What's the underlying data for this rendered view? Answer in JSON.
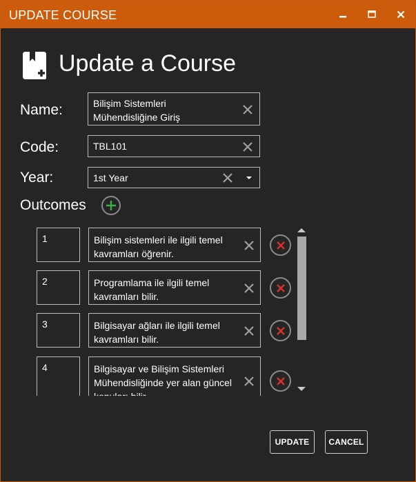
{
  "window": {
    "title": "UPDATE COURSE",
    "accent_color": "#cc5c0b",
    "background_color": "#252526",
    "controls": [
      "minimize-icon",
      "maximize-icon",
      "close-icon"
    ]
  },
  "header": {
    "icon": "book-add-icon",
    "title": "Update a Course"
  },
  "form": {
    "name_label": "Name:",
    "name_value": "Bilişim Sistemleri\nMühendisliğine Giriş",
    "code_label": "Code:",
    "code_value": "TBL101",
    "year_label": "Year:",
    "year_value": "1st Year",
    "outcomes_label": "Outcomes"
  },
  "outcomes": [
    {
      "number": "1",
      "text": "Bilişim sistemleri ile ilgili temel kavramları öğrenir."
    },
    {
      "number": "2",
      "text": "Programlama ile ilgili temel kavramları bilir."
    },
    {
      "number": "3",
      "text": "Bilgisayar ağları ile ilgili temel kavramları bilir."
    },
    {
      "number": "4",
      "text": "Bilgisayar ve Bilişim Sistemleri Mühendisliğinde yer alan güncel konuları bilir."
    }
  ],
  "colors": {
    "add_icon": "#3cb043",
    "delete_icon": "#d9302c",
    "clear_icon": "#a0a0a0"
  },
  "actions": {
    "update_label": "UPDATE",
    "cancel_label": "CANCEL"
  }
}
